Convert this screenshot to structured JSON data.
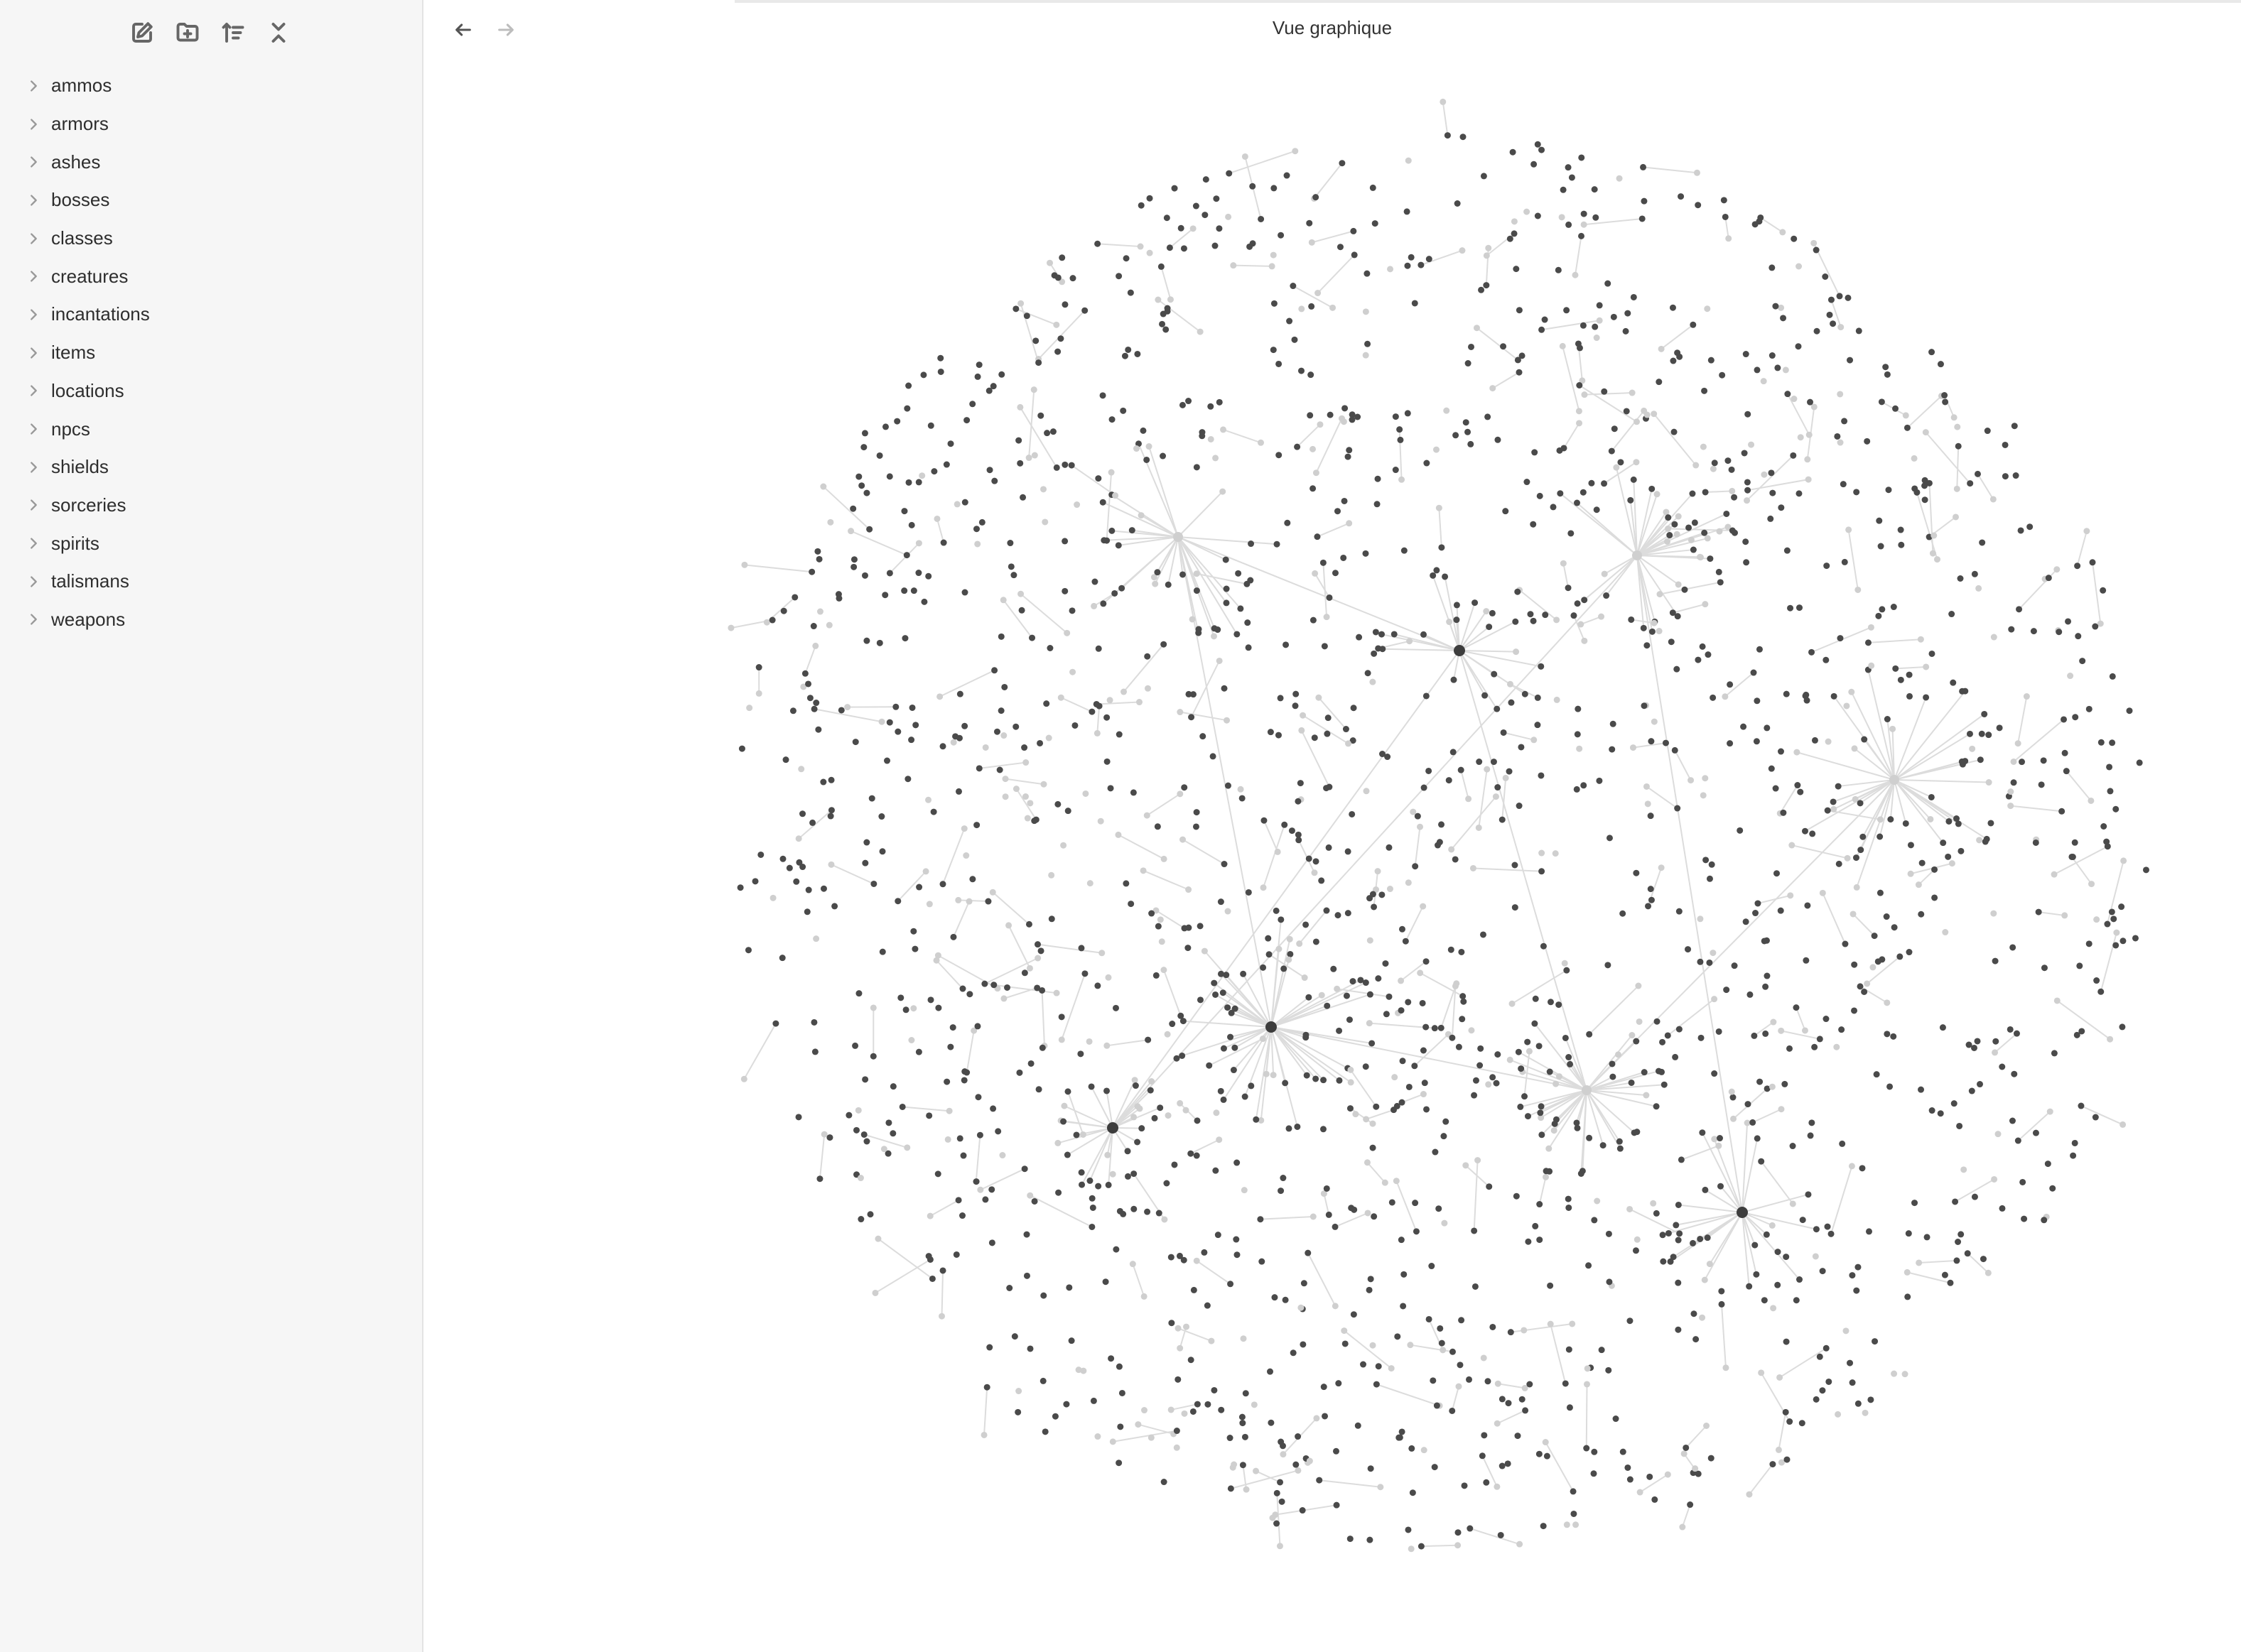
{
  "sidebar": {
    "toolbar": [
      {
        "name": "new-note-button",
        "icon": "pencil-square-icon"
      },
      {
        "name": "new-folder-button",
        "icon": "folder-plus-icon"
      },
      {
        "name": "sort-button",
        "icon": "sort-icon"
      },
      {
        "name": "collapse-all-button",
        "icon": "collapse-icon"
      }
    ],
    "items": [
      {
        "label": "ammos"
      },
      {
        "label": "armors"
      },
      {
        "label": "ashes"
      },
      {
        "label": "bosses"
      },
      {
        "label": "classes"
      },
      {
        "label": "creatures"
      },
      {
        "label": "incantations"
      },
      {
        "label": "items"
      },
      {
        "label": "locations"
      },
      {
        "label": "npcs"
      },
      {
        "label": "shields"
      },
      {
        "label": "sorceries"
      },
      {
        "label": "spirits"
      },
      {
        "label": "talismans"
      },
      {
        "label": "weapons"
      }
    ]
  },
  "header": {
    "title": "Vue graphique",
    "back_icon": "arrow-left-icon",
    "forward_icon": "arrow-right-icon"
  },
  "graph": {
    "node_color": "#4a4a4a",
    "faded_node_color": "#cfcfcf",
    "link_color": "#dcdcdc",
    "hub_count": 4,
    "faded_hub_count": 4
  }
}
